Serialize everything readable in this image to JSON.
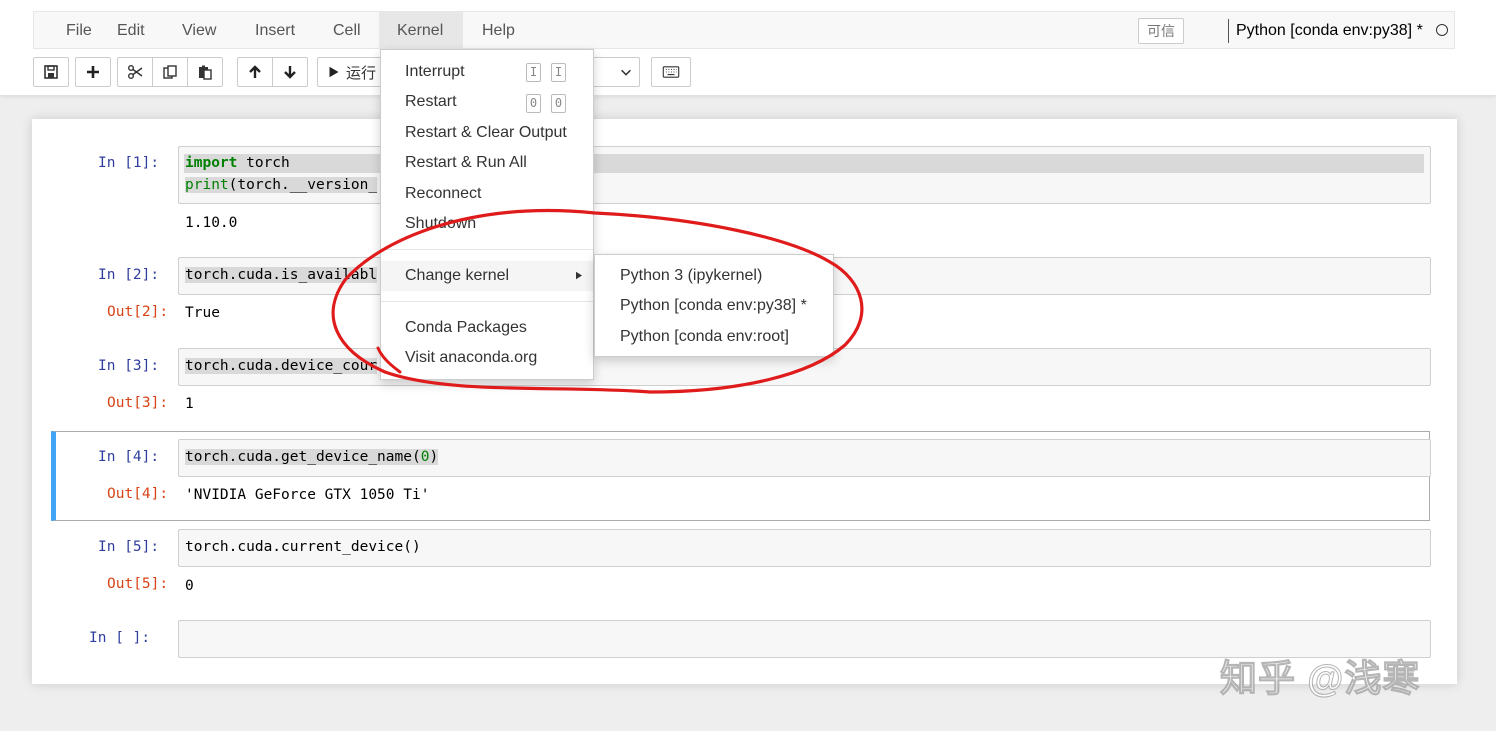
{
  "menubar": {
    "items": [
      "File",
      "Edit",
      "View",
      "Insert",
      "Cell",
      "Kernel",
      "Help"
    ],
    "active": "Kernel"
  },
  "trusted_badge": "可信",
  "kernel_indicator": "Python [conda env:py38] *",
  "toolbar": {
    "run_label": "运行",
    "buttons": [
      "save-icon",
      "plus-icon",
      "scissors-icon",
      "copy-icon",
      "paste-icon",
      "arrow-up-icon",
      "arrow-down-icon",
      "play-icon",
      "keyboard-icon"
    ]
  },
  "kernel_menu": {
    "interrupt": "Interrupt",
    "interrupt_keys": [
      "I",
      "I"
    ],
    "restart": "Restart",
    "restart_keys": [
      "0",
      "0"
    ],
    "restart_clear": "Restart & Clear Output",
    "restart_run": "Restart & Run All",
    "reconnect": "Reconnect",
    "shutdown": "Shutdown",
    "change_kernel": "Change kernel",
    "conda_packages": "Conda Packages",
    "visit_anaconda": "Visit anaconda.org"
  },
  "change_kernel_submenu": [
    "Python 3 (ipykernel)",
    "Python [conda env:py38] *",
    "Python [conda env:root]"
  ],
  "cells": [
    {
      "in_prompt": "In  [1]:",
      "kw": "import",
      "line1_rest": " torch",
      "line2_fn": "print",
      "line2_rest": "(torch.__version_",
      "output": "1.10.0"
    },
    {
      "in_prompt": "In  [2]:",
      "code": "torch.cuda.is_availabl",
      "out_prompt": "Out[2]:",
      "output": "True"
    },
    {
      "in_prompt": "In  [3]:",
      "code": "torch.cuda.device_cour",
      "out_prompt": "Out[3]:",
      "output": "1"
    },
    {
      "in_prompt": "In  [4]:",
      "code_pre": "torch.cuda.get_device_name(",
      "code_num": "0",
      "code_post": ")",
      "out_prompt": "Out[4]:",
      "output": "'NVIDIA GeForce GTX 1050 Ti'"
    },
    {
      "in_prompt": "In  [5]:",
      "code": "torch.cuda.current_device()",
      "out_prompt": "Out[5]:",
      "output": "0"
    },
    {
      "in_prompt": "In  [ ]:"
    }
  ],
  "watermark": "知乎 @浅寒",
  "colors": {
    "in_prompt": "#303f9f",
    "out_prompt": "#d84315",
    "selected_border": "#42a5f5",
    "annotation": "#e01b1b"
  }
}
